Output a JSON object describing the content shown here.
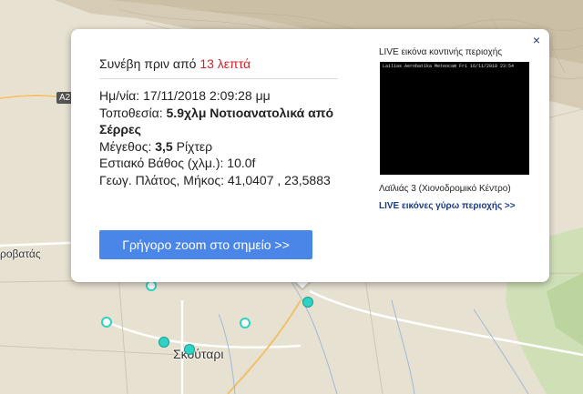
{
  "map": {
    "road_badge": "A2",
    "town_left": "ροβατάς",
    "town_bottom": "Σκούταρι",
    "marker_color": "#2fd3c3"
  },
  "popup": {
    "close_glyph": "×",
    "ago_prefix": "Συνέβη πριν από",
    "ago_value": "13 λεπτά",
    "datetime_label": "Ημ/νία:",
    "datetime_value": "17/11/2018 2:09:28 μμ",
    "location_label": "Τοποθεσία:",
    "location_value": "5.9χλμ Νοτιοανατολικά από Σέρρες",
    "magnitude_label": "Μέγεθος:",
    "magnitude_value": "3,5",
    "magnitude_unit": "Ρίχτερ",
    "depth_label": "Εστιακό Βάθος (χλμ.):",
    "depth_value": "10.0f",
    "coords_label": "Γεωγ. Πλάτος, Μήκος:",
    "coords_value": "41,0407 , 23,5883",
    "zoom_button": "Γρήγορο zoom στο σημείο >>"
  },
  "webcam": {
    "title": "LIVE εικόνα κοντινής περιοχής",
    "caption": "Lailias Aerobatika Meteocam Fri 16/11/2018 23:54",
    "name": "Λαϊλιάς 3 (Χιονοδρομικό Κέντρο)",
    "link": "LIVE εικόνες γύρω περιοχής >>"
  }
}
